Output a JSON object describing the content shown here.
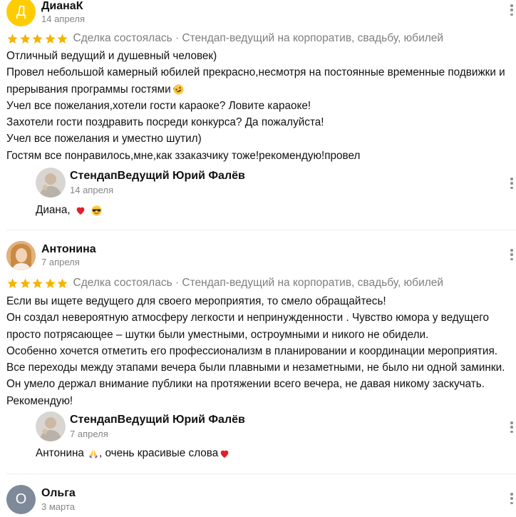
{
  "colors": {
    "star": "#f5b400",
    "avatar_diana": "#ffcc00",
    "avatar_olga": "#7e8a99",
    "meta_text": "#7f7f7f",
    "heart": "#e01f2b"
  },
  "reviews": [
    {
      "author": "ДианаК",
      "avatar_letter": "Д",
      "date": "14 апреля",
      "rating": 5,
      "meta": "Сделка состоялась · Стендап-ведущий на корпоратив, свадьбу, юбилей",
      "lines": [
        "Отличный ведущий и душевный человек)",
        "Провел небольшой камерный юбилей прекрасно,несмотря на постоянные временные подвижки и",
        "прерывания программы гостями",
        "Учел все пожелания,хотели гости караоке? Ловите караоке!",
        "Захотели гости поздравить посреди конкурса? Да пожалуйста!",
        "Учел все пожелания и уместно шутил)",
        "Гостям все понравилось,мне,как ззаказчику тоже!рекомендую!провел"
      ],
      "reply": {
        "author": "СтендапВедущий Юрий Фалёв",
        "date": "14 апреля",
        "text": "Диана,"
      }
    },
    {
      "author": "Антонина",
      "date": "7 апреля",
      "rating": 5,
      "meta": "Сделка состоялась · Стендап-ведущий на корпоратив, свадьбу, юбилей",
      "lines": [
        "Если вы ищете ведущего для своего мероприятия, то смело обращайтесь!",
        "Он создал невероятную атмосферу легкости и непринужденности . Чувство юмора у ведущего",
        "просто потрясающее – шутки были уместными, остроумными и никого не обидели.",
        "Особенно хочется отметить его профессионализм в планировании и координации мероприятия.",
        "Все переходы между этапами вечера были плавными и незаметными, не было ни одной заминки.",
        "Он умело держал внимание публики на протяжении всего вечера, не давая никому заскучать.",
        "Рекомендую!"
      ],
      "reply": {
        "author": "СтендапВедущий Юрий Фалёв",
        "date": "7 апреля",
        "text_before": "Антонина",
        "text_after": ", очень красивые слова"
      }
    },
    {
      "author": "Ольга",
      "avatar_letter": "О",
      "date": "3 марта"
    }
  ]
}
